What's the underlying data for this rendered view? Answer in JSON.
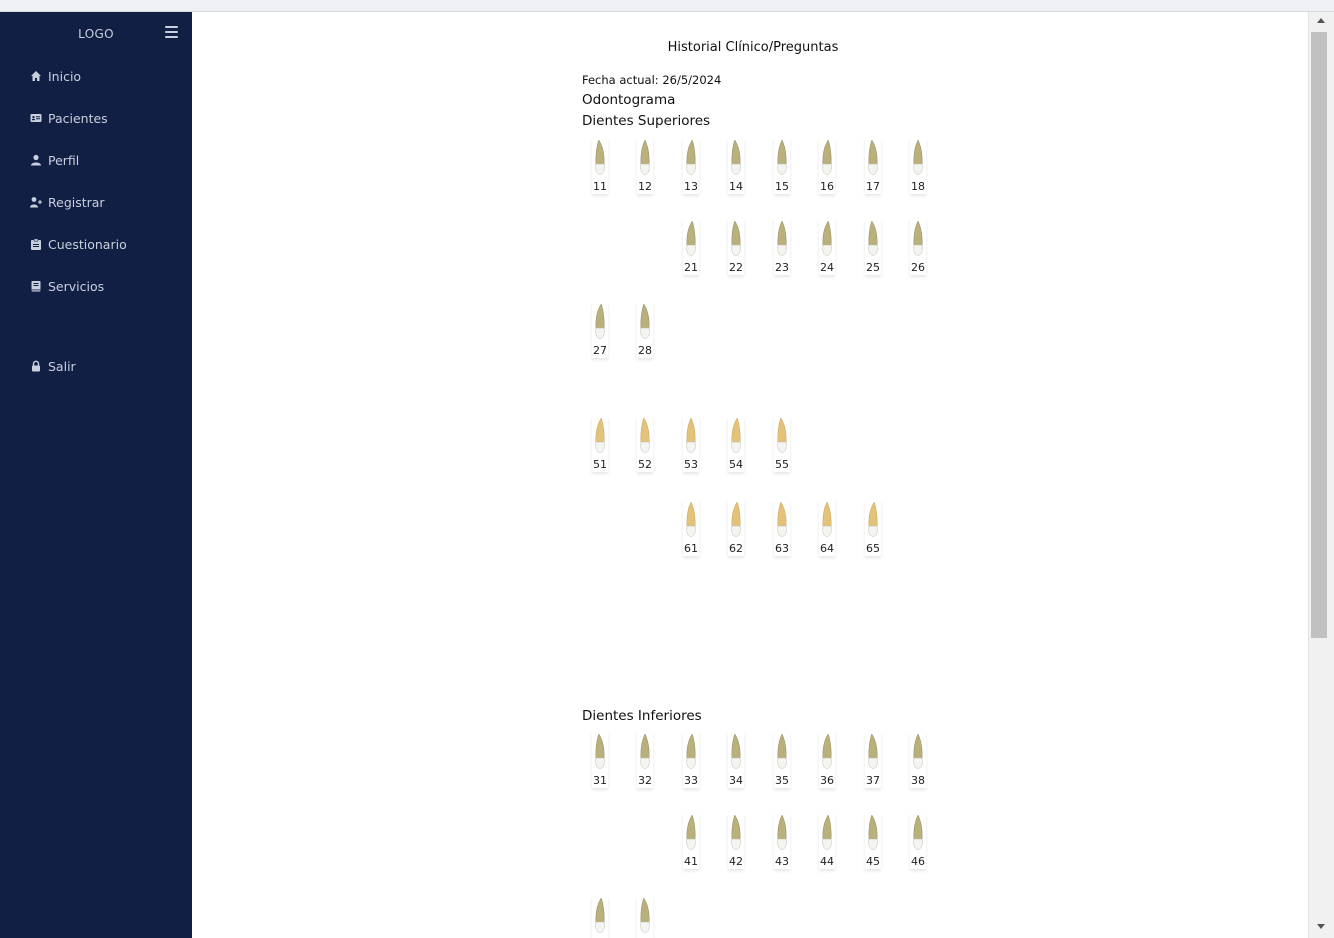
{
  "sidebar": {
    "logo": "LOGO",
    "items": [
      {
        "label": "Inicio",
        "icon": "home-icon"
      },
      {
        "label": "Pacientes",
        "icon": "id-card-icon"
      },
      {
        "label": "Perfil",
        "icon": "user-icon"
      },
      {
        "label": "Registrar",
        "icon": "user-plus-icon"
      },
      {
        "label": "Cuestionario",
        "icon": "clipboard-icon"
      },
      {
        "label": "Servicios",
        "icon": "book-icon"
      },
      {
        "label": "Salir",
        "icon": "lock-icon"
      }
    ]
  },
  "main": {
    "title": "Historial Clínico/Preguntas",
    "date_line": "Fecha actual: 26/5/2024",
    "odontograma": "Odontograma",
    "upper_title": "Dientes Superiores",
    "lower_title": "Dientes Inferiores",
    "upper_teeth": {
      "row1": [
        "11",
        "12",
        "13",
        "14",
        "15",
        "16",
        "17",
        "18"
      ],
      "row2": [
        "21",
        "22",
        "23",
        "24",
        "25",
        "26"
      ],
      "row3": [
        "27",
        "28"
      ]
    },
    "deciduous_teeth": {
      "row1": [
        "51",
        "52",
        "53",
        "54",
        "55"
      ],
      "row2": [
        "61",
        "62",
        "63",
        "64",
        "65"
      ]
    },
    "lower_teeth": {
      "row1": [
        "31",
        "32",
        "33",
        "34",
        "35",
        "36",
        "37",
        "38"
      ],
      "row2": [
        "41",
        "42",
        "43",
        "44",
        "45",
        "46"
      ],
      "row3": [
        "",
        ""
      ]
    }
  },
  "colors": {
    "sidebar_bg": "#121f45",
    "sidebar_text": "#c9cfdc",
    "tooth_root_permanent": "#b9b07c",
    "tooth_root_deciduous": "#e3c27a",
    "tooth_crown": "#f4f4f0"
  }
}
